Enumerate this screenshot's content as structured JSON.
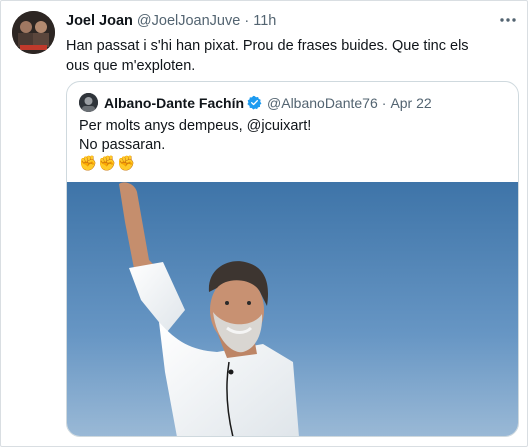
{
  "tweet": {
    "author_name": "Joel Joan",
    "author_handle": "@JoelJoanJuve",
    "separator": "·",
    "time": "11h",
    "text": "Han passat i s'hi han pixat. Prou de frases buides. Que tinc els ous que m'exploten."
  },
  "quoted": {
    "author_name": "Albano-Dante Fachín",
    "author_handle": "@AlbanoDante76",
    "separator": "·",
    "date": "Apr 22",
    "line1": "Per molts anys dempeus, @jcuixart!",
    "line2": "No passaran.",
    "emojis": [
      "✊",
      "✊",
      "✊"
    ],
    "verified_icon": "verified-badge-icon"
  },
  "icons": {
    "more": "more-options-icon"
  },
  "colors": {
    "text": "#0f1419",
    "secondary": "#536471",
    "verified": "#1d9bf0",
    "sky_top": "#3e74a8",
    "sky_bottom": "#8fb6d6"
  }
}
